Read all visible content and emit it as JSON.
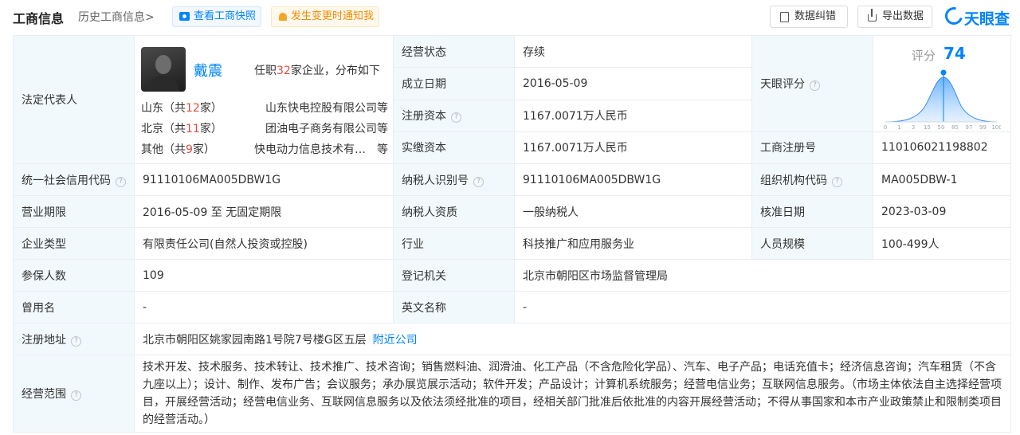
{
  "header": {
    "tab_active": "工商信息",
    "tab_history": "历史工商信息>",
    "snapshot_button": "查看工商快照",
    "notify_button": "发生变更时通知我",
    "correct_button": "数据纠错",
    "export_button": "导出数据",
    "logo_text": "天眼查"
  },
  "legal_rep": {
    "label": "法定代表人",
    "name": "戴震",
    "summary_prefix": "任职",
    "summary_count": "32",
    "summary_suffix": "家企业，分布如下",
    "rows": [
      {
        "prov_name": "山东（共",
        "count": "12",
        "prov_suffix": "家）",
        "company": "山东快电控股有限公司等"
      },
      {
        "prov_name": "北京（共",
        "count": "11",
        "prov_suffix": "家）",
        "company": "团油电子商务有限公司等"
      },
      {
        "prov_name": "其他（共",
        "count": "9",
        "prov_suffix": "家）",
        "company": "快电动力信息技术有…　等"
      }
    ]
  },
  "fields": {
    "status_label": "经营状态",
    "status_value": "存续",
    "established_label": "成立日期",
    "established_value": "2016-05-09",
    "reg_capital_label": "注册资本",
    "reg_capital_value": "1167.0071万人民币",
    "paid_capital_label": "实缴资本",
    "paid_capital_value": "1167.0071万人民币",
    "rating_label": "天眼评分",
    "regno_label": "工商注册号",
    "regno_value": "110106021198802",
    "credit_code_label": "统一社会信用代码",
    "credit_code_value": "91110106MA005DBW1G",
    "taxpayer_id_label": "纳税人识别号",
    "taxpayer_id_value": "91110106MA005DBW1G",
    "org_code_label": "组织机构代码",
    "org_code_value": "MA005DBW-1",
    "term_label": "营业期限",
    "term_value": "2016-05-09 至 无固定期限",
    "taxpayer_qual_label": "纳税人资质",
    "taxpayer_qual_value": "一般纳税人",
    "approved_label": "核准日期",
    "approved_value": "2023-03-09",
    "type_label": "企业类型",
    "type_value": "有限责任公司(自然人投资或控股)",
    "industry_label": "行业",
    "industry_value": "科技推广和应用服务业",
    "staff_label": "人员规模",
    "staff_value": "100-499人",
    "insured_label": "参保人数",
    "insured_value": "109",
    "authority_label": "登记机关",
    "authority_value": "北京市朝阳区市场监督管理局",
    "former_name_label": "曾用名",
    "former_name_value": "-",
    "english_label": "英文名称",
    "english_value": "-",
    "address_label": "注册地址",
    "address_value": "北京市朝阳区姚家园南路1号院7号楼G区五层",
    "address_link": "附近公司",
    "scope_label": "经营范围",
    "scope_value": "技术开发、技术服务、技术转让、技术推广、技术咨询；销售燃料油、润滑油、化工产品（不含危险化学品）、汽车、电子产品；电话充值卡；经济信息咨询；汽车租赁（不含九座以上）；设计、制作、发布广告；会议服务；承办展览展示活动；软件开发；产品设计；计算机系统服务；经营电信业务；互联网信息服务。（市场主体依法自主选择经营项目，开展经营活动；经营电信业务、互联网信息服务以及依法须经批准的项目，经相关部门批准后依批准的内容开展经营活动；不得从事国家和本市产业政策禁止和限制类项目的经营活动。）"
  },
  "score": {
    "label": "评分",
    "value": "74",
    "axis_ticks": [
      "0",
      "1",
      "3",
      "15",
      "50",
      "85",
      "97",
      "99",
      "100"
    ]
  },
  "colors": {
    "accent": "#0084ff",
    "label_bg": "#f2f9fc",
    "highlight": "#e04b3f"
  }
}
